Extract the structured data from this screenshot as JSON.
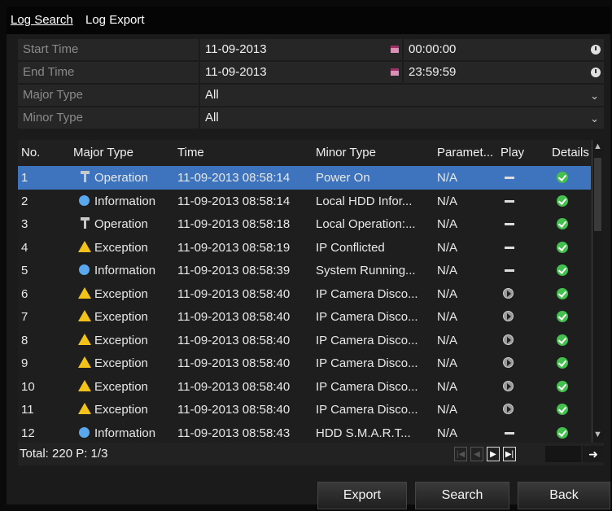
{
  "tabs": [
    {
      "label": "Log Search",
      "active": true
    },
    {
      "label": "Log Export",
      "active": false
    }
  ],
  "form": {
    "start_time": {
      "label": "Start Time",
      "date": "11-09-2013",
      "time": "00:00:00"
    },
    "end_time": {
      "label": "End Time",
      "date": "11-09-2013",
      "time": "23:59:59"
    },
    "major_type": {
      "label": "Major Type",
      "value": "All"
    },
    "minor_type": {
      "label": "Minor Type",
      "value": "All"
    }
  },
  "table": {
    "columns": [
      "No.",
      "Major Type",
      "Time",
      "Minor Type",
      "Paramet...",
      "Play",
      "Details"
    ],
    "rows": [
      {
        "no": "1",
        "major": "Operation",
        "icon": "operation-icon",
        "time": "11-09-2013 08:58:14",
        "minor": "Power On",
        "param": "N/A",
        "play": "none",
        "selected": true
      },
      {
        "no": "2",
        "major": "Information",
        "icon": "information-icon",
        "time": "11-09-2013 08:58:14",
        "minor": "Local HDD Infor...",
        "param": "N/A",
        "play": "none"
      },
      {
        "no": "3",
        "major": "Operation",
        "icon": "operation-icon",
        "time": "11-09-2013 08:58:18",
        "minor": "Local Operation:...",
        "param": "N/A",
        "play": "none"
      },
      {
        "no": "4",
        "major": "Exception",
        "icon": "exception-icon",
        "time": "11-09-2013 08:58:19",
        "minor": "IP Conflicted",
        "param": "N/A",
        "play": "none"
      },
      {
        "no": "5",
        "major": "Information",
        "icon": "information-icon",
        "time": "11-09-2013 08:58:39",
        "minor": "System Running...",
        "param": "N/A",
        "play": "none"
      },
      {
        "no": "6",
        "major": "Exception",
        "icon": "exception-icon",
        "time": "11-09-2013 08:58:40",
        "minor": "IP Camera Disco...",
        "param": "N/A",
        "play": "play"
      },
      {
        "no": "7",
        "major": "Exception",
        "icon": "exception-icon",
        "time": "11-09-2013 08:58:40",
        "minor": "IP Camera Disco...",
        "param": "N/A",
        "play": "play"
      },
      {
        "no": "8",
        "major": "Exception",
        "icon": "exception-icon",
        "time": "11-09-2013 08:58:40",
        "minor": "IP Camera Disco...",
        "param": "N/A",
        "play": "play"
      },
      {
        "no": "9",
        "major": "Exception",
        "icon": "exception-icon",
        "time": "11-09-2013 08:58:40",
        "minor": "IP Camera Disco...",
        "param": "N/A",
        "play": "play"
      },
      {
        "no": "10",
        "major": "Exception",
        "icon": "exception-icon",
        "time": "11-09-2013 08:58:40",
        "minor": "IP Camera Disco...",
        "param": "N/A",
        "play": "play"
      },
      {
        "no": "11",
        "major": "Exception",
        "icon": "exception-icon",
        "time": "11-09-2013 08:58:40",
        "minor": "IP Camera Disco...",
        "param": "N/A",
        "play": "play"
      },
      {
        "no": "12",
        "major": "Information",
        "icon": "information-icon",
        "time": "11-09-2013 08:58:43",
        "minor": "HDD S.M.A.R.T...",
        "param": "N/A",
        "play": "none"
      }
    ]
  },
  "footer": {
    "total": "Total: 220  P: 1/3"
  },
  "buttons": {
    "export": "Export",
    "search": "Search",
    "back": "Back"
  },
  "colors": {
    "selected_row": "#3e73bd",
    "exception": "#f2c21b",
    "information": "#5aa7ee",
    "ok": "#43c04d"
  }
}
